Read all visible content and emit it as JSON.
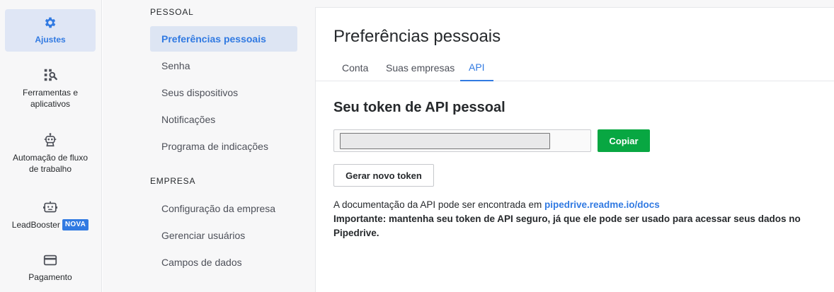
{
  "app_nav": {
    "items": [
      {
        "label": "Ajustes",
        "icon": "gear-icon",
        "active": true
      },
      {
        "label": "Ferramentas e aplicativos",
        "icon": "tools-icon",
        "active": false
      },
      {
        "label": "Automação de fluxo de trabalho",
        "icon": "robot-icon",
        "active": false
      },
      {
        "label": "LeadBooster",
        "icon": "chatbot-icon",
        "active": false,
        "badge": "NOVA"
      },
      {
        "label": "Pagamento",
        "icon": "credit-card-icon",
        "active": false
      }
    ]
  },
  "sub_nav": {
    "personal": {
      "title": "PESSOAL",
      "items": [
        {
          "label": "Preferências pessoais",
          "active": true
        },
        {
          "label": "Senha",
          "active": false
        },
        {
          "label": "Seus dispositivos",
          "active": false
        },
        {
          "label": "Notificações",
          "active": false
        },
        {
          "label": "Programa de indicações",
          "active": false
        }
      ]
    },
    "company": {
      "title": "EMPRESA",
      "items": [
        {
          "label": "Configuração da empresa"
        },
        {
          "label": "Gerenciar usuários"
        },
        {
          "label": "Campos de dados"
        }
      ]
    }
  },
  "main": {
    "title": "Preferências pessoais",
    "tabs": [
      {
        "label": "Conta",
        "active": false
      },
      {
        "label": "Suas empresas",
        "active": false
      },
      {
        "label": "API",
        "active": true
      }
    ],
    "section_title": "Seu token de API pessoal",
    "copy_label": "Copiar",
    "generate_label": "Gerar novo token",
    "doc_prefix": "A documentação da API pode ser encontrada em",
    "doc_link": "pipedrive.readme.io/docs",
    "important": "Importante: mantenha seu token de API seguro, já que ele pode ser usado para acessar seus dados no Pipedrive."
  },
  "colors": {
    "accent": "#317ae2",
    "copy_button": "#08a742",
    "nav_background": "#f7f7f8",
    "active_background": "#dfe6f5"
  }
}
